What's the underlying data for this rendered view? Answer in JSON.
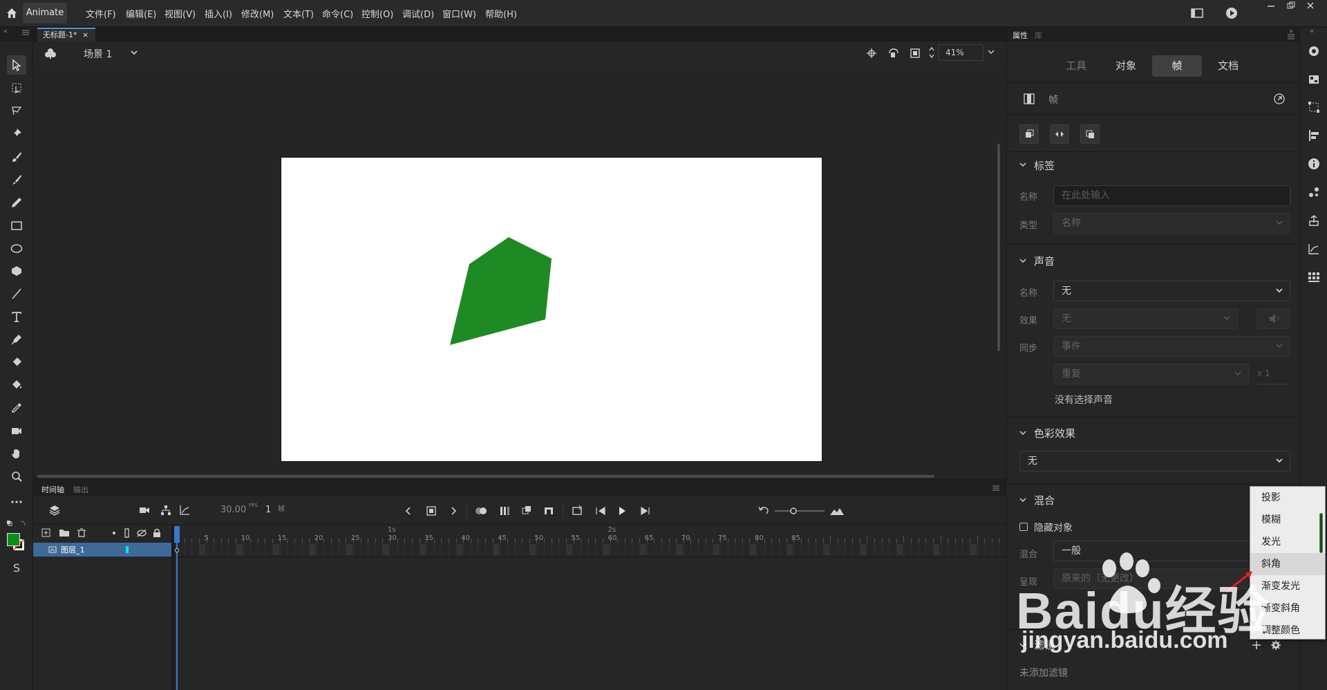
{
  "app": {
    "name": "Animate"
  },
  "menu": [
    "文件(F)",
    "编辑(E)",
    "视图(V)",
    "插入(I)",
    "修改(M)",
    "文本(T)",
    "命令(C)",
    "控制(O)",
    "调试(D)",
    "窗口(W)",
    "帮助(H)"
  ],
  "document": {
    "tab_title": "无标题-1*",
    "close": "×"
  },
  "stage": {
    "scene_label": "场景 1",
    "zoom": "41%",
    "background": "#ffffff",
    "shape_color": "#1e8a24"
  },
  "timeline": {
    "tabs": [
      "时间轴",
      "输出"
    ],
    "fps": "30.00",
    "fps_unit": "FPS",
    "frame": "1",
    "frame_unit": "帧",
    "ruler_ticks": [
      "5",
      "10",
      "15",
      "20",
      "25",
      "30",
      "35",
      "40",
      "45",
      "50",
      "55",
      "60",
      "65",
      "70",
      "75",
      "80",
      "85"
    ],
    "second_marks": [
      "1s",
      "2s"
    ],
    "layers": [
      {
        "name": "图层_1",
        "color": "#00e5ff"
      }
    ]
  },
  "properties": {
    "panel_tabs": [
      "属性",
      "库"
    ],
    "tabs": [
      "工具",
      "对象",
      "帧",
      "文档"
    ],
    "active_tab": "帧",
    "frame_header": "帧",
    "label_section": {
      "title": "标签",
      "name_label": "名称",
      "name_placeholder": "在此处输入",
      "type_label": "类型",
      "type_value": "名称"
    },
    "sound_section": {
      "title": "声音",
      "name_label": "名称",
      "name_value": "无",
      "effect_label": "效果",
      "effect_value": "无",
      "sync_label": "同步",
      "sync_value": "事件",
      "repeat_value": "重复",
      "repeat_count": "x 1",
      "no_sound": "没有选择声音"
    },
    "color_effect_section": {
      "title": "色彩效果",
      "value": "无"
    },
    "blend_section": {
      "title": "混合",
      "hide_object": "隐藏对象",
      "blend_label": "混合",
      "blend_value": "一般",
      "render_label": "呈现",
      "render_value": "原来的（无更改）"
    },
    "filter_section": {
      "title": "滤镜",
      "empty": "未添加滤镜"
    }
  },
  "filter_menu": {
    "items": [
      "投影",
      "模糊",
      "发光",
      "斜角",
      "渐变发光",
      "渐变斜角",
      "调整颜色"
    ],
    "highlighted": "斜角"
  },
  "colors": {
    "stroke": "#1a1a1a",
    "fill": "#0c8f19",
    "accent": "#4a8fe7"
  },
  "watermark": {
    "text": "Baidu经验",
    "url": "jingyan.baidu.com"
  }
}
